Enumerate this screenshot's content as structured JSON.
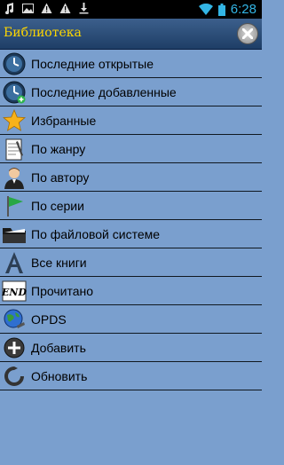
{
  "status_bar": {
    "time": "6:28",
    "left_icons": [
      "music-note-icon",
      "image-icon",
      "warning-icon",
      "warning-icon",
      "download-icon"
    ],
    "right_icons": [
      "wifi-icon",
      "battery-icon"
    ]
  },
  "title_bar": {
    "title": "Библиотека",
    "close_icon": "close-icon"
  },
  "menu": {
    "items": [
      {
        "label": "Последние открытые",
        "icon": "clock-icon"
      },
      {
        "label": "Последние добавленные",
        "icon": "clock-add-icon"
      },
      {
        "label": "Избранные",
        "icon": "star-icon"
      },
      {
        "label": "По жанру",
        "icon": "notepad-icon"
      },
      {
        "label": "По автору",
        "icon": "person-icon"
      },
      {
        "label": "По серии",
        "icon": "flag-icon"
      },
      {
        "label": "По файловой системе",
        "icon": "folder-icon"
      },
      {
        "label": "Все книги",
        "icon": "book-a-icon"
      },
      {
        "label": "Прочитано",
        "icon": "end-icon"
      },
      {
        "label": "OPDS",
        "icon": "globe-icon"
      },
      {
        "label": "Добавить",
        "icon": "plus-circle-icon"
      },
      {
        "label": "Обновить",
        "icon": "refresh-icon"
      }
    ]
  },
  "colors": {
    "background": "#7a9fce",
    "title_text": "#ffd700",
    "status_accent": "#33b5e5"
  }
}
